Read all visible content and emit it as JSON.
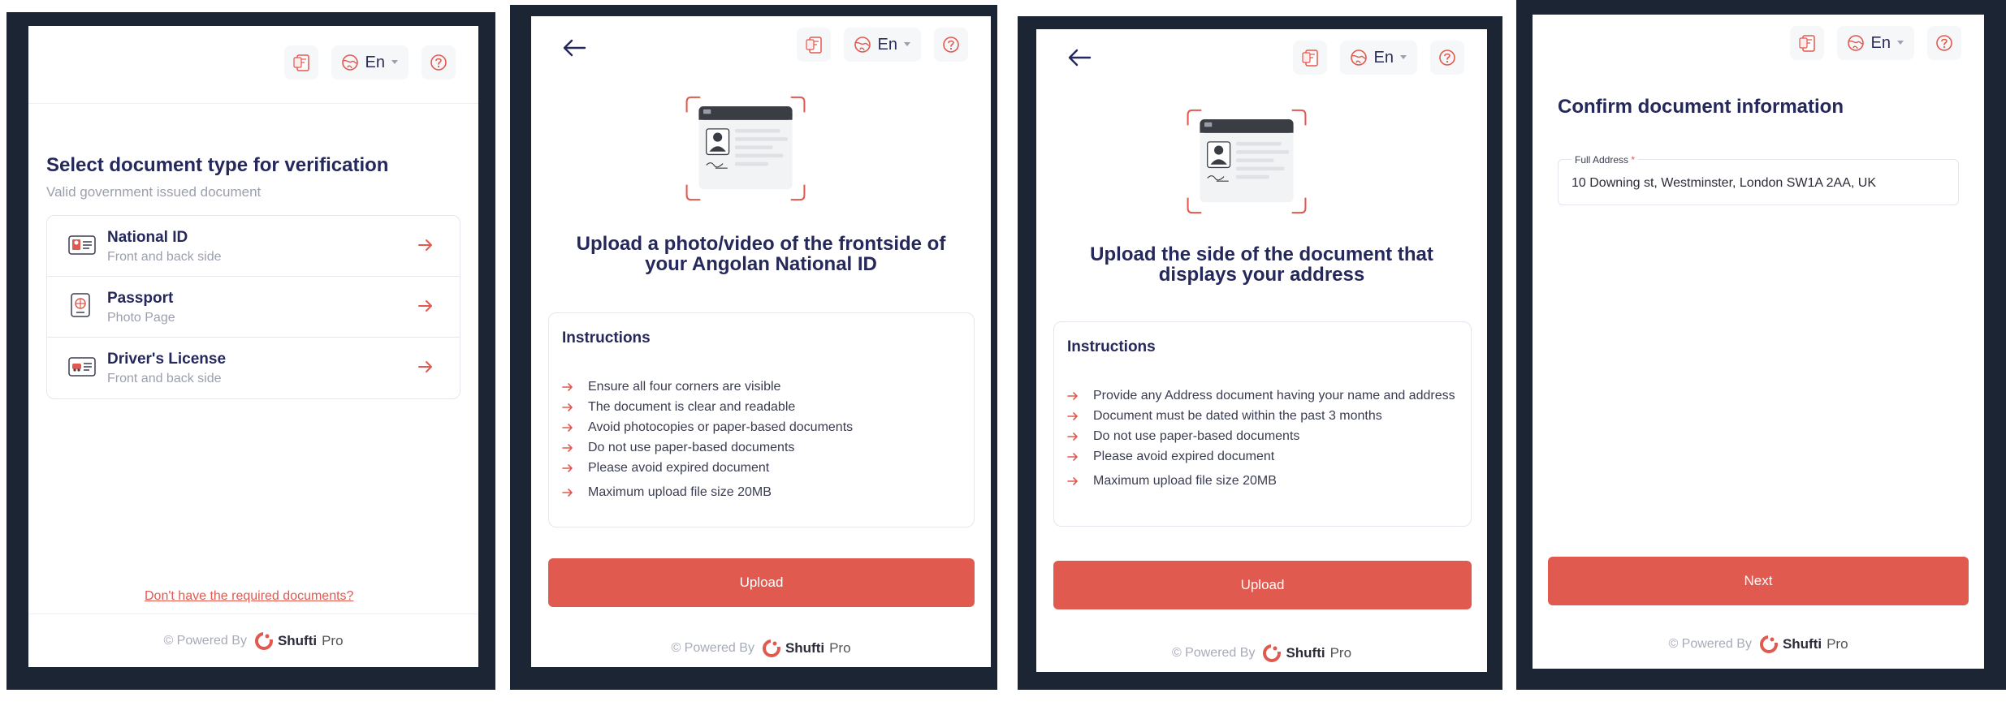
{
  "topbar": {
    "lang": "En"
  },
  "panel1": {
    "title": "Select document type for verification",
    "subtitle": "Valid government issued document",
    "documents": [
      {
        "name": "National ID",
        "desc": "Front and back side",
        "icon": "id-card-icon"
      },
      {
        "name": "Passport",
        "desc": "Photo Page",
        "icon": "passport-icon"
      },
      {
        "name": "Driver's License",
        "desc": "Front and back side",
        "icon": "driver-license-icon"
      }
    ],
    "missing_link": "Don't have the required documents?"
  },
  "panel2": {
    "headline_line1": "Upload a photo/video of the frontside of",
    "headline_line2": "your Angolan National ID",
    "instructions_title": "Instructions",
    "instructions": [
      "Ensure all four corners are visible",
      "The document is clear and readable",
      "Avoid photocopies or paper-based documents",
      "Do not use paper-based documents",
      "Please avoid expired document",
      "Maximum upload file size 20MB"
    ],
    "button": "Upload"
  },
  "panel3": {
    "headline_line1": "Upload the side of the document that",
    "headline_line2": "displays your address",
    "instructions_title": "Instructions",
    "instructions": [
      "Provide any Address document having your name and address",
      "Document must be dated within the past 3 months",
      "Do not use paper-based documents",
      "Please avoid expired document",
      "Maximum upload file size 20MB"
    ],
    "button": "Upload"
  },
  "panel4": {
    "title": "Confirm document information",
    "field_label": "Full Address",
    "field_required": "*",
    "field_value": "10 Downing st, Westminster, London SW1A 2AA, UK",
    "button": "Next"
  },
  "footer": {
    "powered": "© Powered By",
    "brand": "Shufti",
    "brand_suffix": "Pro"
  },
  "colors": {
    "accent": "#e05a50",
    "title": "#25285a",
    "frame": "#1c2533"
  }
}
